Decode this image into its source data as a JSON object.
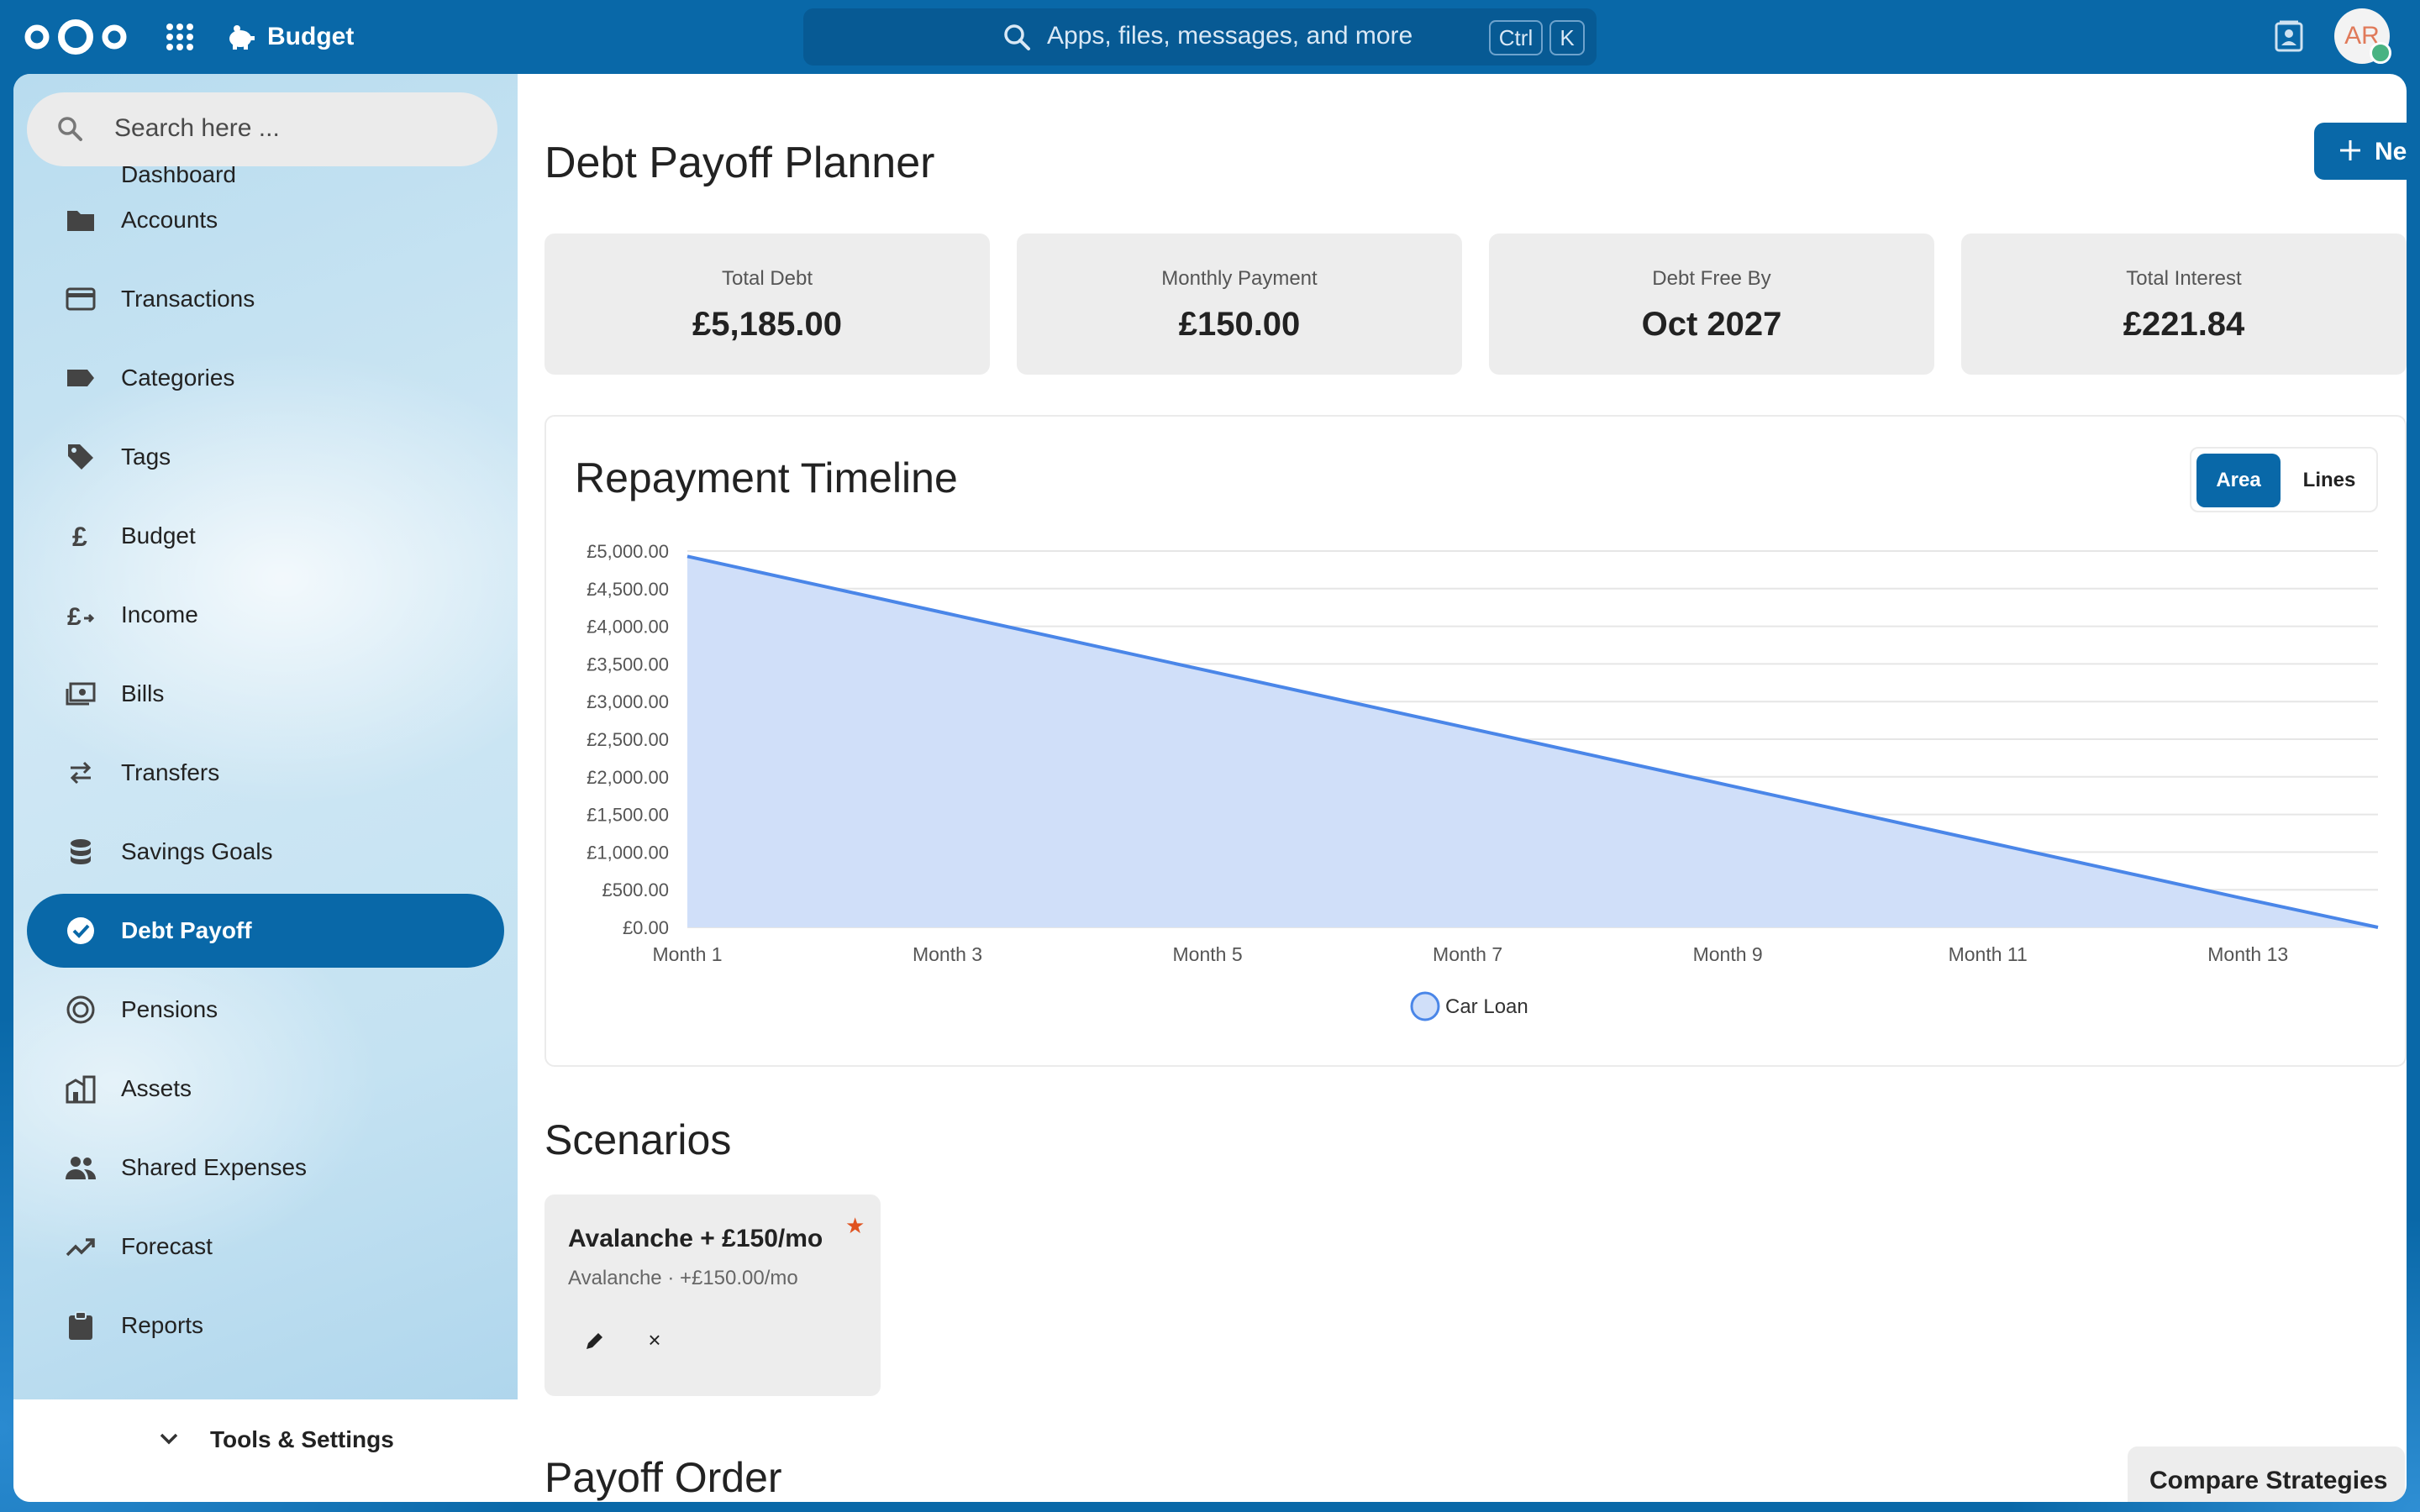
{
  "topbar": {
    "app_name": "Budget",
    "search_placeholder": "Apps, files, messages, and more",
    "shortcut_ctrl": "Ctrl",
    "shortcut_k": "K",
    "avatar_initials": "AR"
  },
  "sidebar": {
    "search_placeholder": "Search here ...",
    "partial_item": "Dashboard",
    "items": [
      {
        "label": "Accounts",
        "icon": "folder-icon"
      },
      {
        "label": "Transactions",
        "icon": "credit-card-icon"
      },
      {
        "label": "Categories",
        "icon": "label-icon"
      },
      {
        "label": "Tags",
        "icon": "tag-icon"
      },
      {
        "label": "Budget",
        "icon": "pound-icon"
      },
      {
        "label": "Income",
        "icon": "pound-arrow-icon"
      },
      {
        "label": "Bills",
        "icon": "cash-icon"
      },
      {
        "label": "Transfers",
        "icon": "swap-icon"
      },
      {
        "label": "Savings Goals",
        "icon": "database-icon"
      },
      {
        "label": "Debt Payoff",
        "icon": "check-circle-icon",
        "active": true
      },
      {
        "label": "Pensions",
        "icon": "target-icon"
      },
      {
        "label": "Assets",
        "icon": "building-icon"
      },
      {
        "label": "Shared Expenses",
        "icon": "people-icon"
      },
      {
        "label": "Forecast",
        "icon": "trending-up-icon"
      },
      {
        "label": "Reports",
        "icon": "clipboard-icon"
      }
    ],
    "tools_settings": "Tools & Settings"
  },
  "main": {
    "title": "Debt Payoff Planner",
    "new_scenario": "New Scenario",
    "stats": [
      {
        "label": "Total Debt",
        "value": "£5,185.00"
      },
      {
        "label": "Monthly Payment",
        "value": "£150.00"
      },
      {
        "label": "Debt Free By",
        "value": "Oct 2027"
      },
      {
        "label": "Total Interest",
        "value": "£221.84"
      }
    ],
    "chart_title": "Repayment Timeline",
    "toggle_area": "Area",
    "toggle_lines": "Lines",
    "scenarios_title": "Scenarios",
    "scenario": {
      "name": "Avalanche + £150/mo",
      "star": "★",
      "subtitle": "Avalanche · +£150.00/mo",
      "delete_symbol": "×"
    },
    "payoff_order_title": "Payoff Order",
    "compare_strategies": "Compare Strategies"
  },
  "colors": {
    "brand": "#0968a8",
    "series_line": "#4a86e8",
    "series_fill": "#d0dff9",
    "star": "#e0521f"
  },
  "chart_data": {
    "type": "area",
    "title": "Repayment Timeline",
    "x": [
      "Month 1",
      "Month 2",
      "Month 3",
      "Month 4",
      "Month 5",
      "Month 6",
      "Month 7",
      "Month 8",
      "Month 9",
      "Month 10",
      "Month 11",
      "Month 12",
      "Month 13",
      "Month 14"
    ],
    "x_tick_labels": [
      "Month 1",
      "Month 3",
      "Month 5",
      "Month 7",
      "Month 9",
      "Month 11",
      "Month 13"
    ],
    "y_tick_labels": [
      "£0.00",
      "£500.00",
      "£1,000.00",
      "£1,500.00",
      "£2,000.00",
      "£2,500.00",
      "£3,000.00",
      "£3,500.00",
      "£4,000.00",
      "£4,500.00",
      "£5,000.00"
    ],
    "ylim": [
      0,
      5000
    ],
    "grid": true,
    "legend_position": "bottom",
    "series": [
      {
        "name": "Car Loan",
        "values": [
          4930,
          4550,
          4170,
          3790,
          3410,
          3030,
          2650,
          2270,
          1890,
          1510,
          1130,
          750,
          370,
          0
        ]
      }
    ]
  }
}
